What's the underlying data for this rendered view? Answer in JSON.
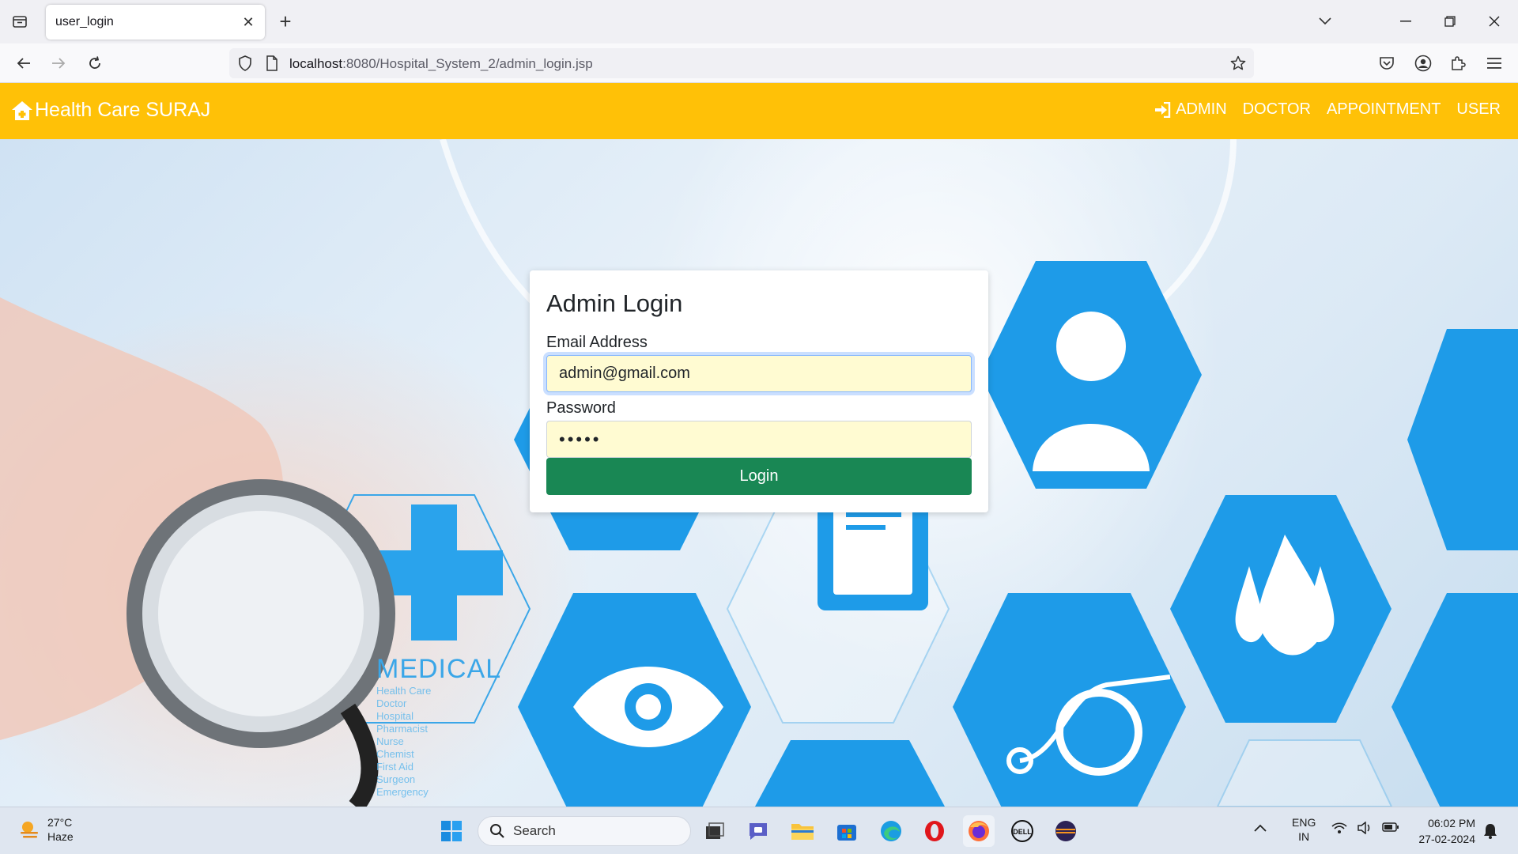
{
  "browser": {
    "tab_title": "user_login",
    "url_host": "localhost",
    "url_rest": ":8080/Hospital_System_2/admin_login.jsp"
  },
  "site": {
    "brand": "Health Care SURAJ",
    "menu": [
      {
        "label": "ADMIN",
        "icon": "sign-in-icon"
      },
      {
        "label": "DOCTOR"
      },
      {
        "label": "APPOINTMENT"
      },
      {
        "label": "USER"
      }
    ],
    "colors": {
      "navbar": "#ffc107",
      "button": "#198754"
    }
  },
  "hero": {
    "medical_title": "MEDICAL",
    "medical_items": [
      "Health Care",
      "Doctor",
      "Hospital",
      "Pharmacist",
      "Nurse",
      "Chemist",
      "First Aid",
      "Surgeon",
      "Emergency"
    ]
  },
  "login": {
    "title": "Admin Login",
    "email_label": "Email Address",
    "email_value": "admin@gmail.com",
    "password_label": "Password",
    "password_value": "admin",
    "button_label": "Login"
  },
  "taskbar": {
    "weather_temp": "27°C",
    "weather_desc": "Haze",
    "search_placeholder": "Search",
    "lang_top": "ENG",
    "lang_bottom": "IN",
    "time": "06:02 PM",
    "date": "27-02-2024"
  }
}
